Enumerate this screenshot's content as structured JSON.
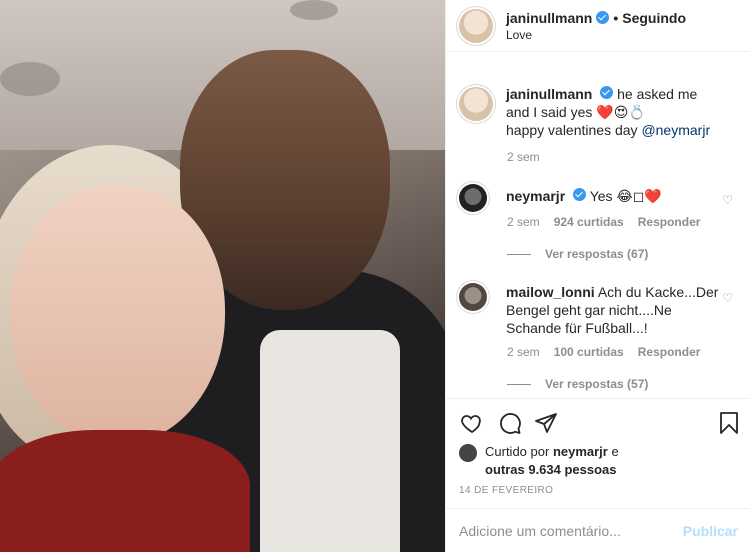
{
  "header": {
    "username": "janinullmann",
    "dot": "•",
    "follow_status": "Seguindo",
    "location": "Love"
  },
  "caption": {
    "username": "janinullmann",
    "text": "he asked me and I said yes ❤️😍💍",
    "text2": "happy valentines day",
    "mention": "@neymarjr",
    "time": "2 sem"
  },
  "comments": [
    {
      "username": "neymarjr",
      "text": "Yes 😂◻❤️",
      "time": "2 sem",
      "likes": "924 curtidas",
      "reply": "Responder",
      "view_replies": "Ver respostas (67)"
    },
    {
      "username": "mailow_lonni",
      "text": "Ach du Kacke...Der Bengel geht gar nicht....Ne Schande für Fußball...!",
      "time": "2 sem",
      "likes": "100 curtidas",
      "reply": "Responder",
      "view_replies": "Ver respostas (57)"
    }
  ],
  "likes_summary": {
    "prefix": "Curtido por",
    "user": "neymarjr",
    "middle": "e",
    "others": "outras 9.634 pessoas"
  },
  "date": "14 DE FEVEREIRO",
  "add_comment": {
    "placeholder": "Adicione um comentário...",
    "post_label": "Publicar"
  },
  "icons": {
    "like": "heart-icon",
    "comment": "comment-icon",
    "share": "paper-plane-icon",
    "save": "bookmark-icon"
  }
}
